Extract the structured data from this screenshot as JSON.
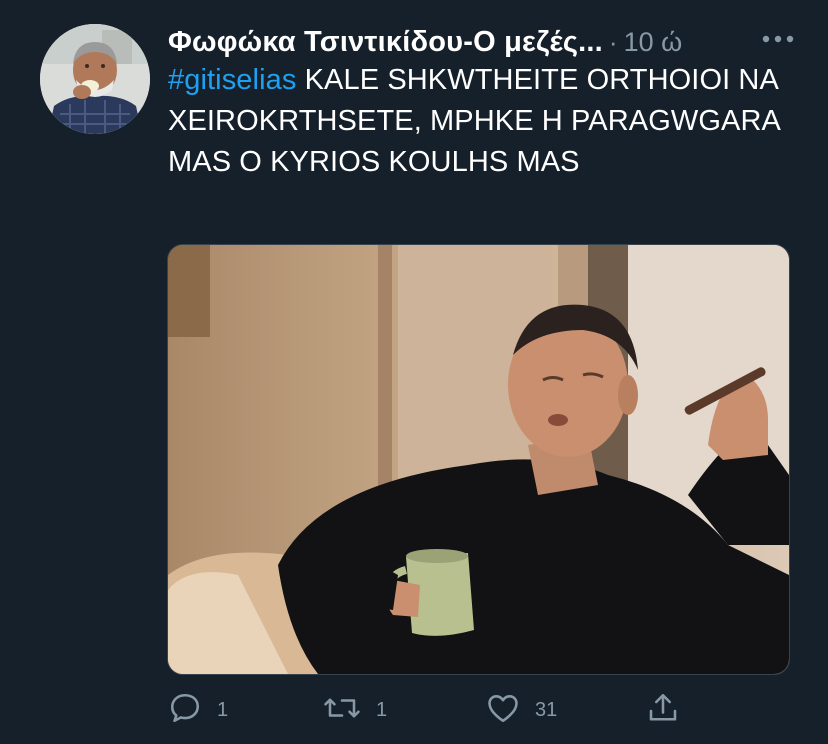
{
  "author": {
    "display_name": "Φωφώκα Τσιντικίδου-Ο μεζές...",
    "separator": "·",
    "timestamp": "10 ώ"
  },
  "tweet": {
    "hashtag": "#gitiselias",
    "text": " KALE SHKWTHEITE ORTHOIOI NA XEIROKRTHSETE, MPHKE H PARAGWGARA MAS O KYRIOS KOULHS MAS"
  },
  "actions": {
    "reply_count": "1",
    "retweet_count": "1",
    "like_count": "31"
  },
  "colors": {
    "background": "#15202b",
    "text": "#ffffff",
    "secondary": "#8899a6",
    "accent": "#1da1f2"
  },
  "icons": {
    "more": "more-horizontal-icon",
    "reply": "reply-icon",
    "retweet": "retweet-icon",
    "like": "heart-icon",
    "share": "share-icon"
  }
}
